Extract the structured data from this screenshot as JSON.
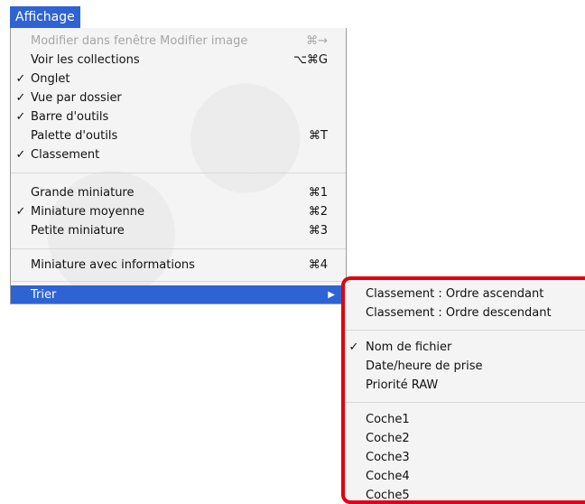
{
  "menu": {
    "title": "Affichage",
    "items": [
      {
        "label": "Modifier dans fenêtre Modifier image",
        "shortcut": "⌘→",
        "checked": false,
        "disabled": true
      },
      {
        "label": "Voir les collections",
        "shortcut": "⌥⌘G",
        "checked": false
      },
      {
        "label": "Onglet",
        "shortcut": "",
        "checked": true
      },
      {
        "label": "Vue par dossier",
        "shortcut": "",
        "checked": true
      },
      {
        "label": "Barre d'outils",
        "shortcut": "",
        "checked": true
      },
      {
        "label": "Palette d'outils",
        "shortcut": "⌘T",
        "checked": false
      },
      {
        "label": "Classement",
        "shortcut": "",
        "checked": true
      },
      {
        "label": "Grande miniature",
        "shortcut": "⌘1",
        "checked": false
      },
      {
        "label": "Miniature moyenne",
        "shortcut": "⌘2",
        "checked": true
      },
      {
        "label": "Petite miniature",
        "shortcut": "⌘3",
        "checked": false
      },
      {
        "label": "Miniature avec informations",
        "shortcut": "⌘4",
        "checked": false
      },
      {
        "label": "Trier",
        "shortcut": "",
        "checked": false,
        "highlighted": true,
        "submenu_arrow": "▶"
      }
    ],
    "check_mark": "✓"
  },
  "submenu": {
    "items": [
      {
        "label": "Classement : Ordre ascendant",
        "checked": false
      },
      {
        "label": "Classement : Ordre descendant",
        "checked": false
      },
      {
        "label": "Nom de fichier",
        "checked": true
      },
      {
        "label": "Date/heure de prise",
        "checked": false
      },
      {
        "label": "Priorité RAW",
        "checked": false
      },
      {
        "label": "Coche1",
        "checked": false
      },
      {
        "label": "Coche2",
        "checked": false
      },
      {
        "label": "Coche3",
        "checked": false
      },
      {
        "label": "Coche4",
        "checked": false
      },
      {
        "label": "Coche5",
        "checked": false
      }
    ]
  },
  "colors": {
    "highlight": "#2f63d4",
    "callout_border": "#e00010"
  }
}
